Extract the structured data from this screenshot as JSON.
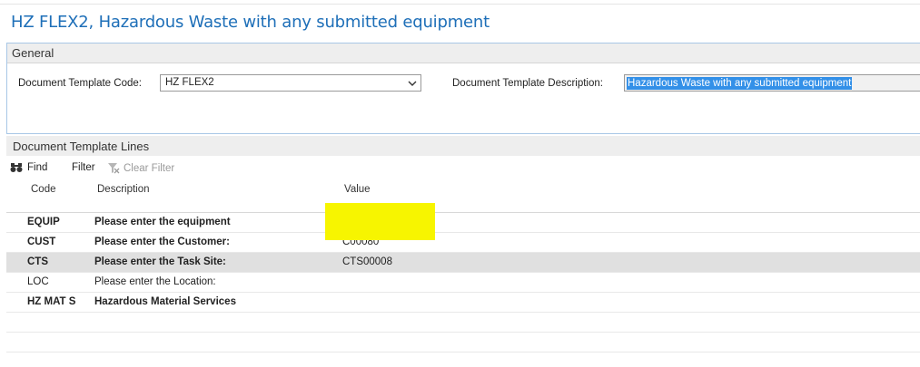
{
  "page": {
    "title": "HZ FLEX2, Hazardous Waste with any submitted equipment"
  },
  "general": {
    "section_title": "General",
    "code_label": "Document Template Code:",
    "code_value": "HZ FLEX2",
    "description_label": "Document Template Description:",
    "description_value": "Hazardous Waste with any submitted equipment"
  },
  "lines": {
    "section_title": "Document Template Lines",
    "toolbar": {
      "find": "Find",
      "filter": "Filter",
      "clear_filter": "Clear Filter"
    },
    "columns": {
      "code": "Code",
      "description": "Description",
      "value": "Value"
    },
    "rows": [
      {
        "code": "EQUIP",
        "description": "Please enter the equipment",
        "value": "",
        "bold": true
      },
      {
        "code": "CUST",
        "description": "Please enter the Customer:",
        "value": "C00080",
        "bold": true
      },
      {
        "code": "CTS",
        "description": "Please enter the Task Site:",
        "value": "CTS00008",
        "bold": true,
        "selected": true
      },
      {
        "code": "LOC",
        "description": "Please enter the Location:",
        "value": "",
        "bold": false
      },
      {
        "code": "HZ MAT S",
        "description": "Hazardous Material Services",
        "value": "",
        "bold": true
      }
    ]
  },
  "colors": {
    "title": "#1e6fb8",
    "selection": "#3390e8",
    "highlight": "#f7f500",
    "selected_row": "#e0e0e0"
  }
}
